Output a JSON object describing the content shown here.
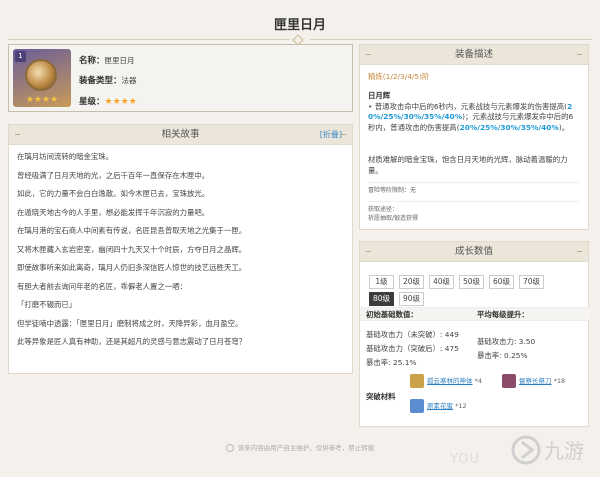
{
  "page_title": "匣里日月",
  "info": {
    "badge": "1",
    "name_key": "名称：",
    "name_val": "匣里日月",
    "type_key": "装备类型：",
    "type_val": "法器",
    "star_key": "星级：",
    "stars": "★★★★",
    "rating_stars": "★★★★"
  },
  "story": {
    "title": "相关故事",
    "fold": "[折叠]",
    "paragraphs": [
      "在璃月坊间流转的暗金宝珠。",
      "曾经吸满了日月天地的光，之后千百年一直保存在木匣中。",
      "如此，它的力量不会白白逸散。如今木匣已去，宝珠放光。",
      "在遁晓天地古今的人手里，想必能发挥千年沉寂的力量吧。",
      "在璃月港的宝石商人中间素有传说，名匠昆吾曾取天地之光集于一匣。",
      "又将木匣藏入玄岩密室，幽闭四十九天又十个时辰，方夺日月之晶辉。",
      "即使故事听来如此离奇，璃月人仍旧多深信匠人惊世的技艺远胜天工。",
      "有胆大者前去询问年老的名匠，乖僻老人置之一哂：",
      "「打磨不辍而已」",
      "但学徒喃中透露：「匣里日月」磨制将成之时，天降异彩，血月盈空。",
      "此等异象是匠人真有神助，还是其超凡的灵感与意志震动了日月苍穹？"
    ]
  },
  "equip": {
    "title": "装备描述",
    "refine": "精炼(1/2/3/4/5)阶",
    "skill_name": "日月辉",
    "skill_p1": "• 普通攻击命中后的6秒内，元素战技与元素爆发的伤害提高(",
    "skill_hl1a": "2",
    "skill_hl1b": "0%/25%/30%/35%/40%",
    "skill_p1_end": ")；元素战技与元素爆发命中后的6秒内，普通攻击的伤害提高(",
    "skill_hl2": "20%/25%/30%/35%/40%",
    "skill_p2_end": ")。",
    "lore": "材质难解的暗金宝珠，饱含日月天地的光辉，脉动着温暖的力量。",
    "limit": "冒险等阶限制：无",
    "source_label": "获取途径：",
    "source": "祈愿抽取/锻造获得"
  },
  "growth": {
    "title": "成长数值",
    "levels": [
      "1级",
      "20级",
      "40级",
      "50级",
      "60级",
      "70级",
      "80级",
      "90级"
    ],
    "active_level": "80级",
    "base_head": "初始基础数值：",
    "avg_head": "平均每级提升：",
    "base_atk_nb": "基础攻击力（未突破）: 449",
    "base_atk_b": "基础攻击力（突破后）: 475",
    "crit": "暴击率: 25.1%",
    "avg_atk": "基础攻击力: 3.50",
    "avg_crit": "暴击率: 0.25%",
    "mat_label": "突破材料",
    "materials": [
      {
        "name": "孤云寒林的神体",
        "count": "*4",
        "color": "#c9a24a"
      },
      {
        "name": "督察长祭刀",
        "count": "*18",
        "color": "#8a4c6a"
      },
      {
        "name": "原素花蜜",
        "count": "*12",
        "color": "#5b8bd0"
      }
    ]
  },
  "footer": {
    "note": "该条内容由用户自主维护，仅供参考，禁止转载"
  },
  "watermark": "YOU",
  "logo_text": "九游"
}
